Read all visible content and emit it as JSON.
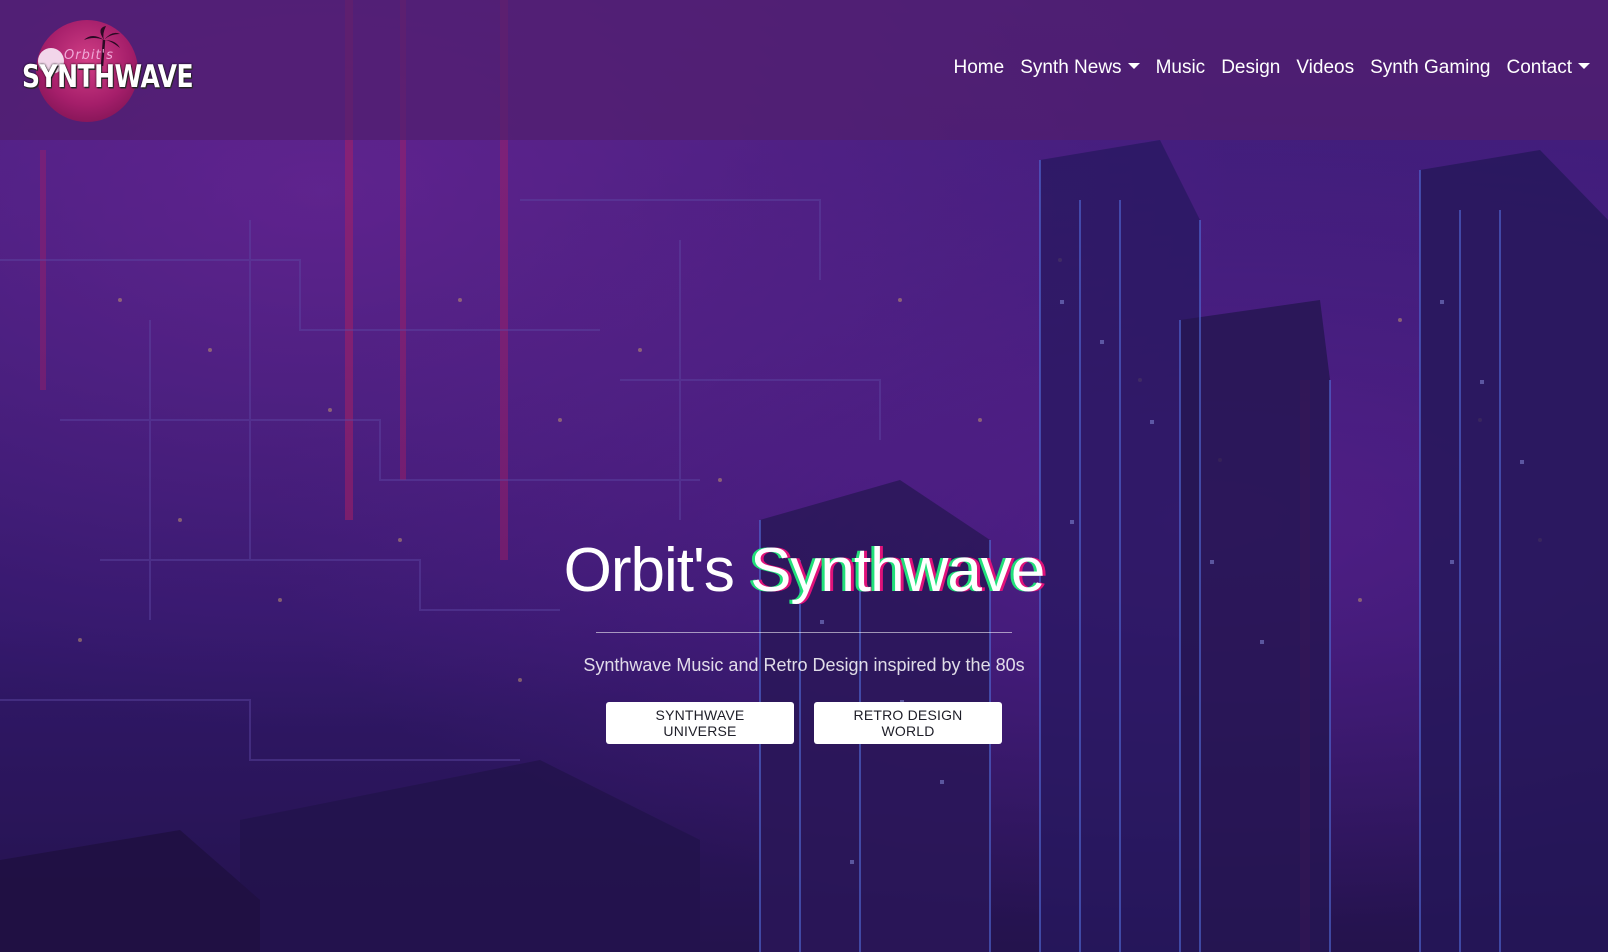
{
  "brand": {
    "logo_small_text": "Orbit's",
    "logo_main_text": "SYNTHWAVE"
  },
  "nav": {
    "items": [
      {
        "label": "Home",
        "dropdown": false
      },
      {
        "label": "Synth News",
        "dropdown": true
      },
      {
        "label": "Music",
        "dropdown": false
      },
      {
        "label": "Design",
        "dropdown": false
      },
      {
        "label": "Videos",
        "dropdown": false
      },
      {
        "label": "Synth Gaming",
        "dropdown": false
      },
      {
        "label": "Contact",
        "dropdown": true
      }
    ]
  },
  "hero": {
    "title_prefix": "Orbit's",
    "title_accent": "Synthwave",
    "subtitle": "Synthwave Music and Retro Design inspired by the 80s",
    "buttons": [
      {
        "label": "SYNTHWAVE UNIVERSE"
      },
      {
        "label": "RETRO DESIGN WORLD"
      }
    ]
  },
  "colors": {
    "navbar_bg": "#501e6e",
    "accent_green": "#22e07a",
    "accent_pink": "#e0127a",
    "button_bg": "#ffffff"
  }
}
